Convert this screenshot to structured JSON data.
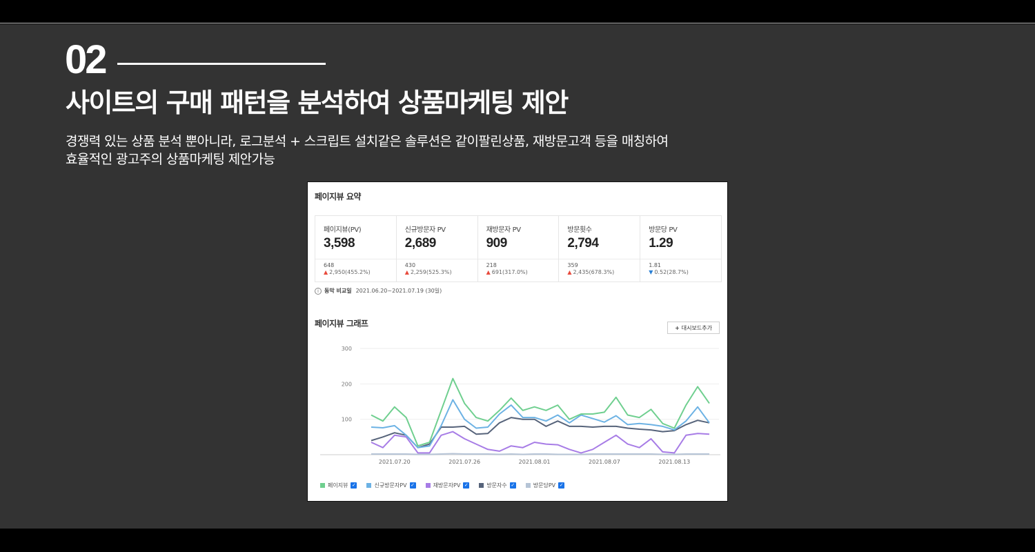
{
  "slide": {
    "section_number": "02",
    "headline": "사이트의 구매 패턴을 분석하여 상품마케팅 제안",
    "description_lines": [
      "경쟁력 있는 상품 분석 뿐아니라, 로그분석 + 스크립트 설치같은 솔루션은 같이팔린상품, 재방문고객 등을 매칭하여",
      "효율적인 광고주의 상품마케팅 제안가능"
    ]
  },
  "panel": {
    "summary_title": "페이지뷰 요약",
    "kpis": [
      {
        "label": "페이지뷰(PV)",
        "value": "3,598",
        "prev": "648",
        "diff": "2,950(455.2%)",
        "trend": "up"
      },
      {
        "label": "신규방문자 PV",
        "value": "2,689",
        "prev": "430",
        "diff": "2,259(525.3%)",
        "trend": "up"
      },
      {
        "label": "재방문자 PV",
        "value": "909",
        "prev": "218",
        "diff": "691(317.0%)",
        "trend": "up"
      },
      {
        "label": "방문횟수",
        "value": "2,794",
        "prev": "359",
        "diff": "2,435(678.3%)",
        "trend": "up"
      },
      {
        "label": "방문당 PV",
        "value": "1.29",
        "prev": "1.81",
        "diff": "0.52(28.7%)",
        "trend": "down"
      }
    ],
    "compare_label": "동막 비교일",
    "compare_period": "2021.06.20~2021.07.19 (30일)",
    "graph_title": "페이지뷰 그래프",
    "dashboard_button": "대시보드추가",
    "legend": [
      {
        "name": "페이지뷰",
        "color": "#6fcf8f"
      },
      {
        "name": "신규방문자PV",
        "color": "#6cb2e4"
      },
      {
        "name": "재방문자PV",
        "color": "#a77ce6"
      },
      {
        "name": "방문자수",
        "color": "#56637a"
      },
      {
        "name": "방문당PV",
        "color": "#b6c4d6"
      }
    ]
  },
  "chart_data": {
    "type": "line",
    "ylim": [
      0,
      300
    ],
    "y_ticks": [
      "100",
      "200",
      "300"
    ],
    "x_tick_labels": [
      "2021.07.20",
      "2021.07.26",
      "2021.08.01",
      "2021.08.07",
      "2021.08.13"
    ],
    "x_tick_index": [
      2,
      8,
      14,
      20,
      26
    ],
    "series": [
      {
        "name": "페이지뷰",
        "color": "#6fcf8f",
        "values": [
          112,
          95,
          135,
          105,
          25,
          35,
          125,
          215,
          145,
          105,
          95,
          125,
          160,
          125,
          135,
          125,
          140,
          100,
          115,
          115,
          120,
          162,
          112,
          105,
          128,
          88,
          75,
          140,
          192,
          145
        ]
      },
      {
        "name": "신규방문자PV",
        "color": "#6cb2e4",
        "values": [
          78,
          76,
          82,
          55,
          20,
          25,
          82,
          155,
          100,
          75,
          78,
          115,
          140,
          105,
          105,
          95,
          112,
          90,
          112,
          102,
          92,
          110,
          85,
          88,
          85,
          80,
          70,
          95,
          135,
          90
        ]
      },
      {
        "name": "재방문자PV",
        "color": "#a77ce6",
        "values": [
          35,
          20,
          55,
          50,
          5,
          5,
          55,
          65,
          45,
          30,
          15,
          10,
          25,
          20,
          35,
          30,
          28,
          15,
          5,
          15,
          35,
          55,
          30,
          20,
          45,
          8,
          5,
          55,
          60,
          58
        ]
      },
      {
        "name": "방문자수",
        "color": "#56637a",
        "values": [
          40,
          50,
          62,
          55,
          20,
          30,
          78,
          78,
          80,
          58,
          60,
          90,
          105,
          100,
          100,
          80,
          95,
          80,
          80,
          78,
          80,
          80,
          75,
          72,
          70,
          65,
          68,
          85,
          97,
          90
        ]
      },
      {
        "name": "방문당PV",
        "color": "#b6c4d6",
        "values": [
          2,
          2,
          2,
          2,
          1,
          1,
          2,
          3,
          2,
          2,
          2,
          1,
          2,
          1,
          2,
          2,
          1,
          1,
          1,
          2,
          2,
          2,
          2,
          2,
          2,
          1,
          1,
          2,
          2,
          2
        ]
      }
    ]
  }
}
